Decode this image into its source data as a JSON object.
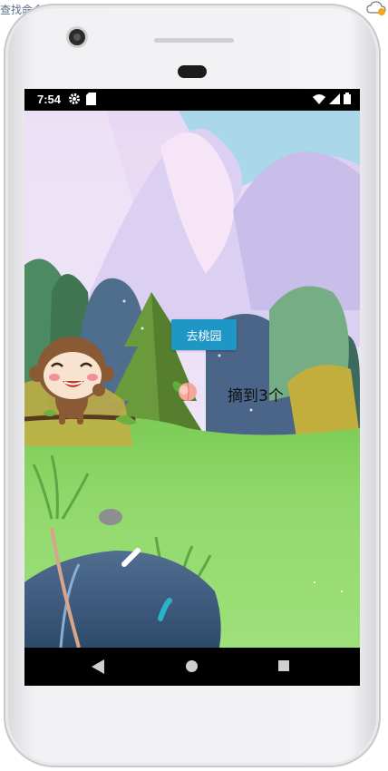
{
  "host": {
    "top_left_text": "查找命令",
    "top_right_icon": "cloud-sync-icon"
  },
  "status_bar": {
    "time": "7:54",
    "icons": [
      "gear-icon",
      "sd-card-icon",
      "wifi-icon",
      "signal-icon",
      "battery-icon"
    ]
  },
  "scene": {
    "go_button_label": "去桃园",
    "count_text": "摘到3个",
    "colors": {
      "sky": "#e8dcf5",
      "grass": "#8fd66a",
      "button": "#1f97c6"
    }
  },
  "nav_bar": {
    "buttons": [
      "back-icon",
      "home-icon",
      "recents-icon"
    ]
  }
}
